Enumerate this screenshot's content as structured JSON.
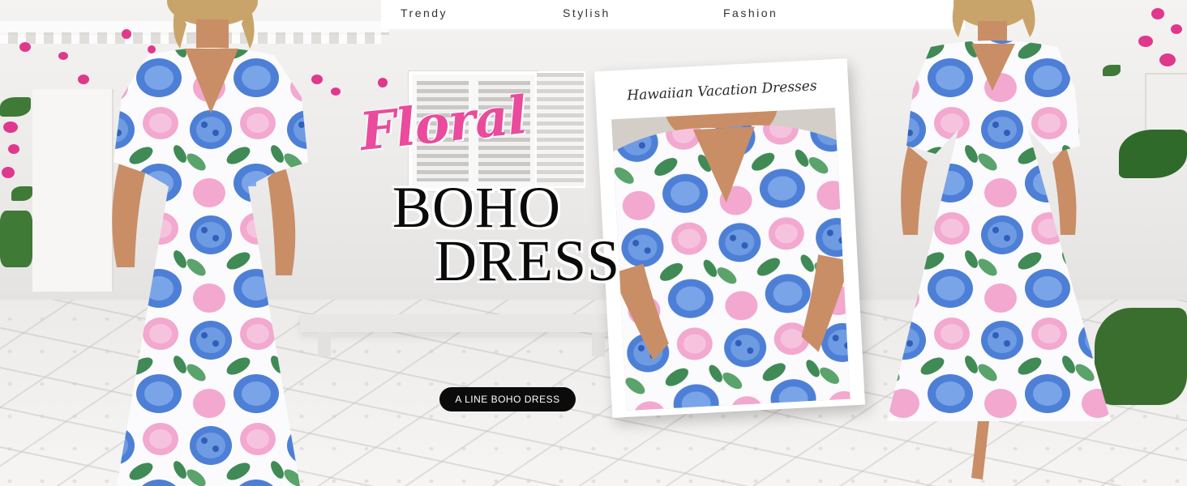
{
  "nav": {
    "items": [
      "Trendy",
      "Stylish",
      "Fashion"
    ]
  },
  "headline": {
    "script_word": "Floral",
    "line1": "BOHO",
    "line2": "DRESS"
  },
  "polaroid": {
    "caption": "Hawaiian Vacation Dresses"
  },
  "cta": {
    "label": "A LINE BOHO DRESS"
  },
  "palette": {
    "script_pink": "#ea4b9c",
    "headline_black": "#0a0a0a",
    "hydrangea_blue": "#4d7fd6",
    "hydrangea_pink": "#f2a8cf",
    "leaf_green": "#3f8a55",
    "dress_white": "#fbfbfd",
    "skin": "#c98e66",
    "hair": "#c9a46a"
  },
  "icons": [
    "floral-print-pattern"
  ]
}
